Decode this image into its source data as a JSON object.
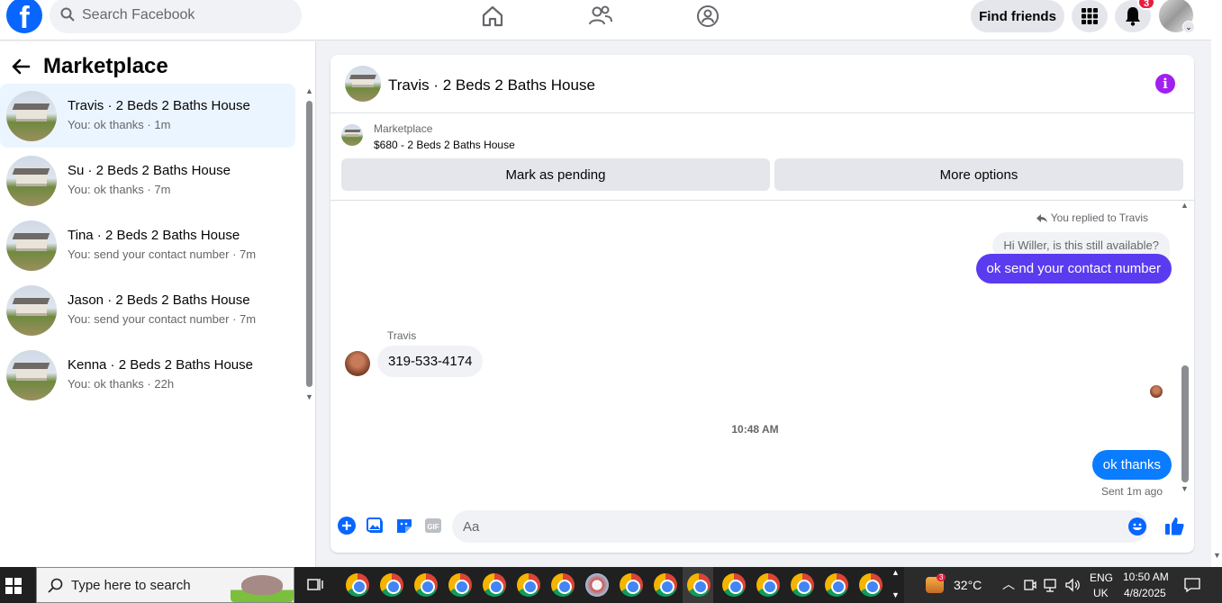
{
  "topbar": {
    "search_placeholder": "Search Facebook",
    "find_friends": "Find friends",
    "notification_count": "3"
  },
  "marketplace": {
    "title": "Marketplace",
    "conversations": [
      {
        "name": "Travis · 2 Beds 2 Baths House",
        "snippet": "You: ok thanks · 1m"
      },
      {
        "name": "Su · 2 Beds 2 Baths House",
        "snippet": "You: ok thanks · 7m"
      },
      {
        "name": "Tina · 2 Beds 2 Baths House",
        "snippet": "You: send your contact number · 7m"
      },
      {
        "name": "Jason · 2 Beds 2 Baths House",
        "snippet": "You: send your contact number · 7m"
      },
      {
        "name": "Kenna · 2 Beds 2 Baths House",
        "snippet": "You: ok thanks · 22h"
      }
    ]
  },
  "chat": {
    "title": "Travis · 2 Beds 2 Baths House",
    "listing_source": "Marketplace",
    "listing_price": "$680 - 2 Beds 2 Baths House",
    "mark_pending": "Mark as pending",
    "more_options": "More options",
    "replied_label": "You replied to Travis",
    "quoted_message": "Hi Willer, is this still available?",
    "out_message_1": "ok send your contact number",
    "sender_name": "Travis",
    "in_message_1": "319-533-4174",
    "time_separator": "10:48 AM",
    "out_message_2": "ok thanks",
    "sent_status": "Sent 1m ago",
    "composer_placeholder": "Aa",
    "colors": {
      "accent_purple": "#5b3bf0",
      "accent_blue": "#0a7cff",
      "info": "#a020f0"
    }
  },
  "taskbar": {
    "search_placeholder": "Type here to search",
    "weather_badge": "3",
    "temperature": "32°C",
    "lang_1": "ENG",
    "lang_2": "UK",
    "time": "10:50 AM",
    "date": "4/8/2025"
  }
}
